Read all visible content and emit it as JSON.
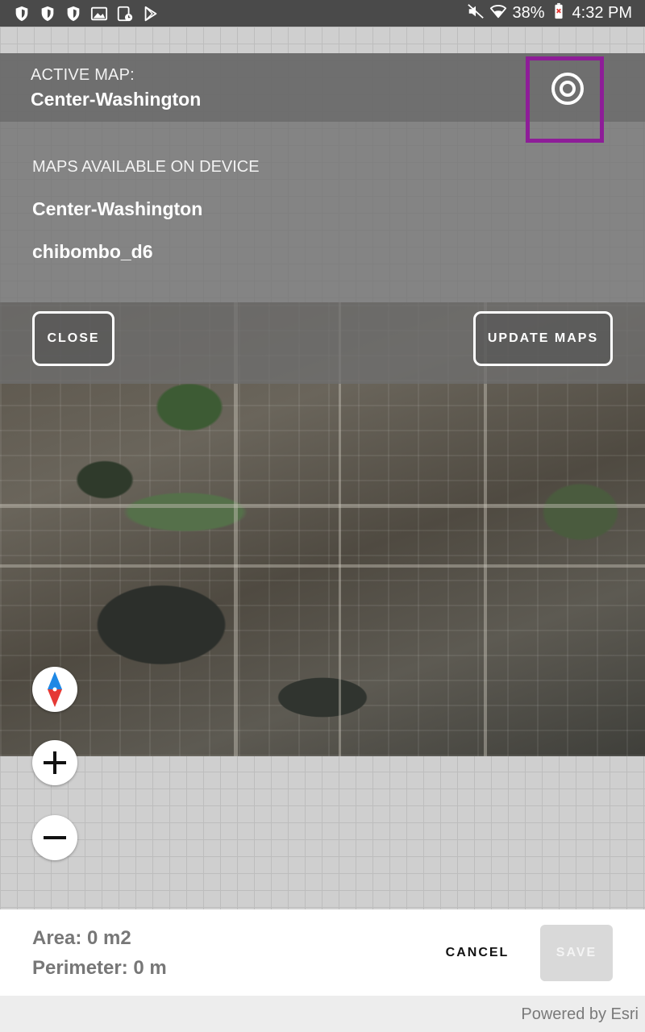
{
  "status_bar": {
    "left_icons": [
      "shield-icon",
      "shield-icon",
      "shield-icon",
      "image-icon",
      "device-icon",
      "play-store-icon"
    ],
    "battery": "38%",
    "time": "4:32 PM"
  },
  "active_map": {
    "label": "ACTIVE MAP:",
    "name": "Center-Washington"
  },
  "maps_available": {
    "title": "MAPS AVAILABLE ON DEVICE",
    "items": [
      "Center-Washington",
      "chibombo_d6"
    ]
  },
  "buttons": {
    "close": "CLOSE",
    "update_maps": "UPDATE MAPS",
    "cancel": "CANCEL",
    "save": "SAVE"
  },
  "measure": {
    "area": "Area: 0 m2",
    "perimeter": "Perimeter: 0 m"
  },
  "attribution": "Powered by Esri",
  "colors": {
    "highlight": "#8e1d98",
    "compass_north": "#e53935",
    "compass_south": "#1e88e5"
  }
}
